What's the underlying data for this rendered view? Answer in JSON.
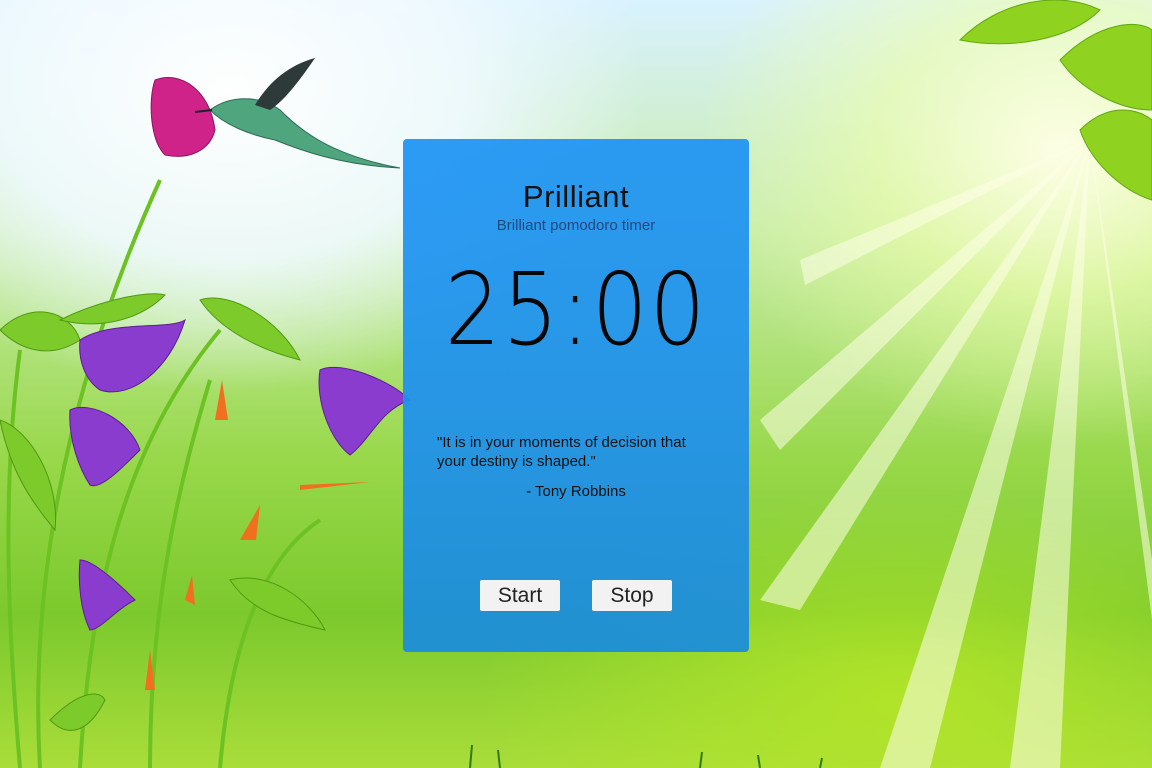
{
  "app": {
    "title": "Prilliant",
    "subtitle": "Brilliant pomodoro timer"
  },
  "timer": {
    "display": "25:00"
  },
  "quote": {
    "text": "\"It is in your moments of decision that your destiny is shaped.\"",
    "author": "- Tony Robbins"
  },
  "controls": {
    "start_label": "Start",
    "stop_label": "Stop"
  },
  "colors": {
    "panel": "#2196f3",
    "button": "#f2f2f2",
    "text": "#111111"
  }
}
